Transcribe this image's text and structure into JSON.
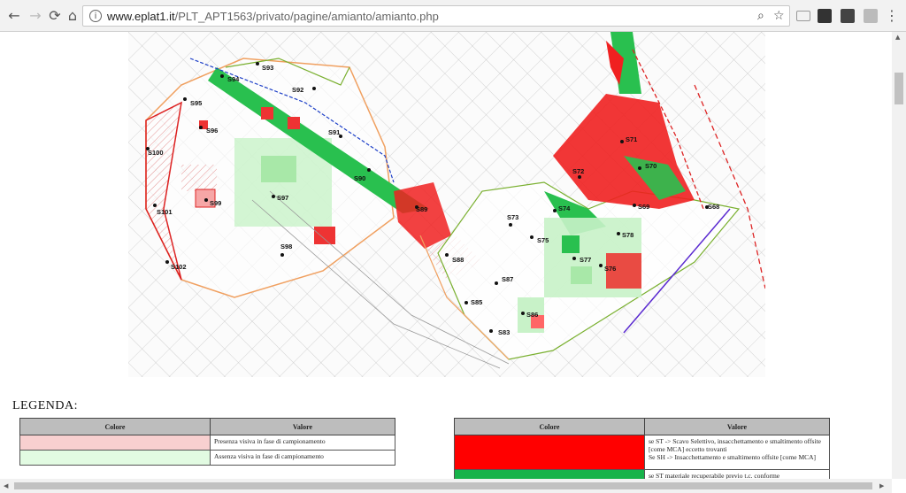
{
  "browser": {
    "url_host": "www.eplat1.it",
    "url_path": "/PLT_APT1563/privato/pagine/amianto/amianto.php"
  },
  "map": {
    "samples": [
      {
        "id": "S93"
      },
      {
        "id": "S94"
      },
      {
        "id": "S92"
      },
      {
        "id": "S95"
      },
      {
        "id": "S96"
      },
      {
        "id": "S91"
      },
      {
        "id": "S100"
      },
      {
        "id": "S90"
      },
      {
        "id": "S97"
      },
      {
        "id": "S99"
      },
      {
        "id": "S89"
      },
      {
        "id": "S101"
      },
      {
        "id": "S98"
      },
      {
        "id": "S102"
      },
      {
        "id": "S88"
      },
      {
        "id": "S73"
      },
      {
        "id": "S75"
      },
      {
        "id": "S74"
      },
      {
        "id": "S72"
      },
      {
        "id": "S71"
      },
      {
        "id": "S70"
      },
      {
        "id": "S69"
      },
      {
        "id": "S68"
      },
      {
        "id": "S78"
      },
      {
        "id": "S77"
      },
      {
        "id": "S76"
      },
      {
        "id": "S87"
      },
      {
        "id": "S85"
      },
      {
        "id": "S86"
      },
      {
        "id": "S83"
      }
    ]
  },
  "legend": {
    "title": "LEGENDA:",
    "table1": {
      "header_color": "Colore",
      "header_value": "Valore",
      "rows": [
        {
          "color": "#f8d0d0",
          "text": "Presenza visiva in fase di campionamento"
        },
        {
          "color": "#e2fbe2",
          "text": "Assenza visiva in fase di campionamento"
        }
      ]
    },
    "table2": {
      "header_color": "Colore",
      "header_value": "Valore",
      "rows": [
        {
          "color": "#ff0000",
          "line1": "se ST -> Scavo Selettivo, insacchettamento e smaltimento offsite",
          "line2": "[come MCA] eccetto trovanti",
          "line3": "Se SH -> Insacchettamento e smaltimento offsite [come MCA]"
        },
        {
          "color": "#17b34a",
          "line1": "se ST materiale recuperabile previo t.c. conforme"
        }
      ]
    }
  }
}
